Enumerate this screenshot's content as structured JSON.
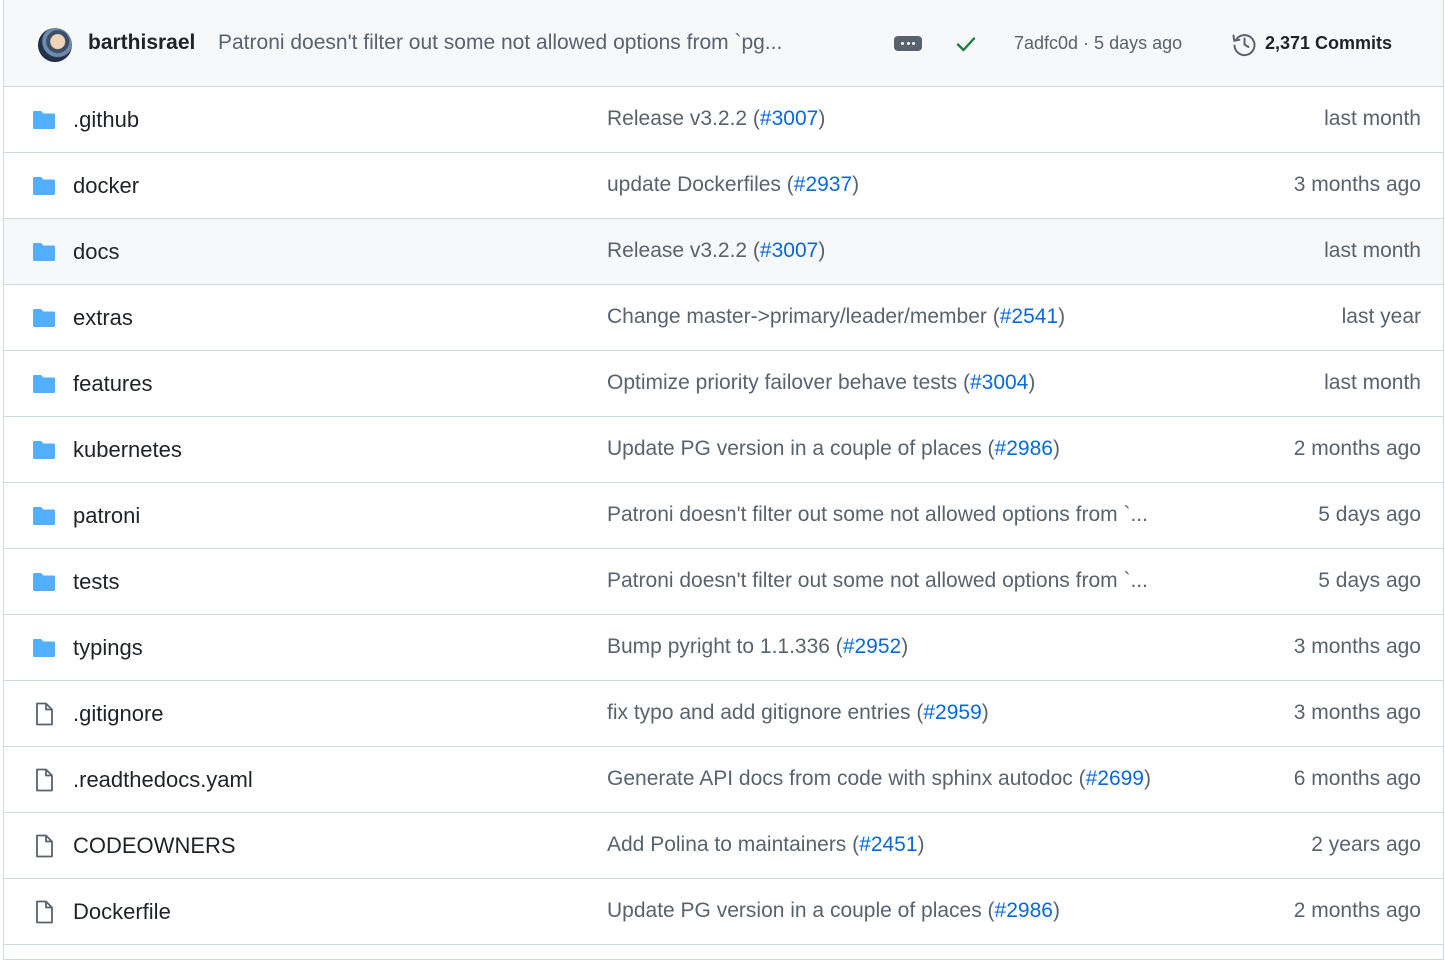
{
  "latest_commit": {
    "author": "barthisrael",
    "message": "Patroni doesn't filter out some not allowed options from `pg...",
    "status": "success",
    "sha_and_date": "7adfc0d · 5 days ago",
    "commits_label": "2,371 Commits"
  },
  "colors": {
    "link": "#0969da",
    "muted": "#59636e",
    "folder": "#54aeff",
    "success": "#1a7f37",
    "border": "#d0d7de"
  },
  "files": [
    {
      "type": "folder",
      "name": ".github",
      "msg_text": "Release v3.2.2 (",
      "pr": "#3007",
      "msg_tail": ")",
      "age": "last month"
    },
    {
      "type": "folder",
      "name": "docker",
      "msg_text": "update Dockerfiles (",
      "pr": "#2937",
      "msg_tail": ")",
      "age": "3 months ago"
    },
    {
      "type": "folder",
      "name": "docs",
      "msg_text": "Release v3.2.2 (",
      "pr": "#3007",
      "msg_tail": ")",
      "age": "last month"
    },
    {
      "type": "folder",
      "name": "extras",
      "msg_text": "Change master->primary/leader/member (",
      "pr": "#2541",
      "msg_tail": ")",
      "age": "last year"
    },
    {
      "type": "folder",
      "name": "features",
      "msg_text": "Optimize priority failover behave tests (",
      "pr": "#3004",
      "msg_tail": ")",
      "age": "last month"
    },
    {
      "type": "folder",
      "name": "kubernetes",
      "msg_text": "Update PG version in a couple of places (",
      "pr": "#2986",
      "msg_tail": ")",
      "age": "2 months ago"
    },
    {
      "type": "folder",
      "name": "patroni",
      "msg_text": "Patroni doesn't filter out some not allowed options from `...",
      "pr": "",
      "msg_tail": "",
      "age": "5 days ago"
    },
    {
      "type": "folder",
      "name": "tests",
      "msg_text": "Patroni doesn't filter out some not allowed options from `...",
      "pr": "",
      "msg_tail": "",
      "age": "5 days ago"
    },
    {
      "type": "folder",
      "name": "typings",
      "msg_text": "Bump pyright to 1.1.336 (",
      "pr": "#2952",
      "msg_tail": ")",
      "age": "3 months ago"
    },
    {
      "type": "file",
      "name": ".gitignore",
      "msg_text": "fix typo and add gitignore entries (",
      "pr": "#2959",
      "msg_tail": ")",
      "age": "3 months ago"
    },
    {
      "type": "file",
      "name": ".readthedocs.yaml",
      "msg_text": "Generate API docs from code with sphinx autodoc (",
      "pr": "#2699",
      "msg_tail": ")",
      "age": "6 months ago"
    },
    {
      "type": "file",
      "name": "CODEOWNERS",
      "msg_text": "Add Polina to maintainers (",
      "pr": "#2451",
      "msg_tail": ")",
      "age": "2 years ago"
    },
    {
      "type": "file",
      "name": "Dockerfile",
      "msg_text": "Update PG version in a couple of places (",
      "pr": "#2986",
      "msg_tail": ")",
      "age": "2 months ago"
    }
  ]
}
